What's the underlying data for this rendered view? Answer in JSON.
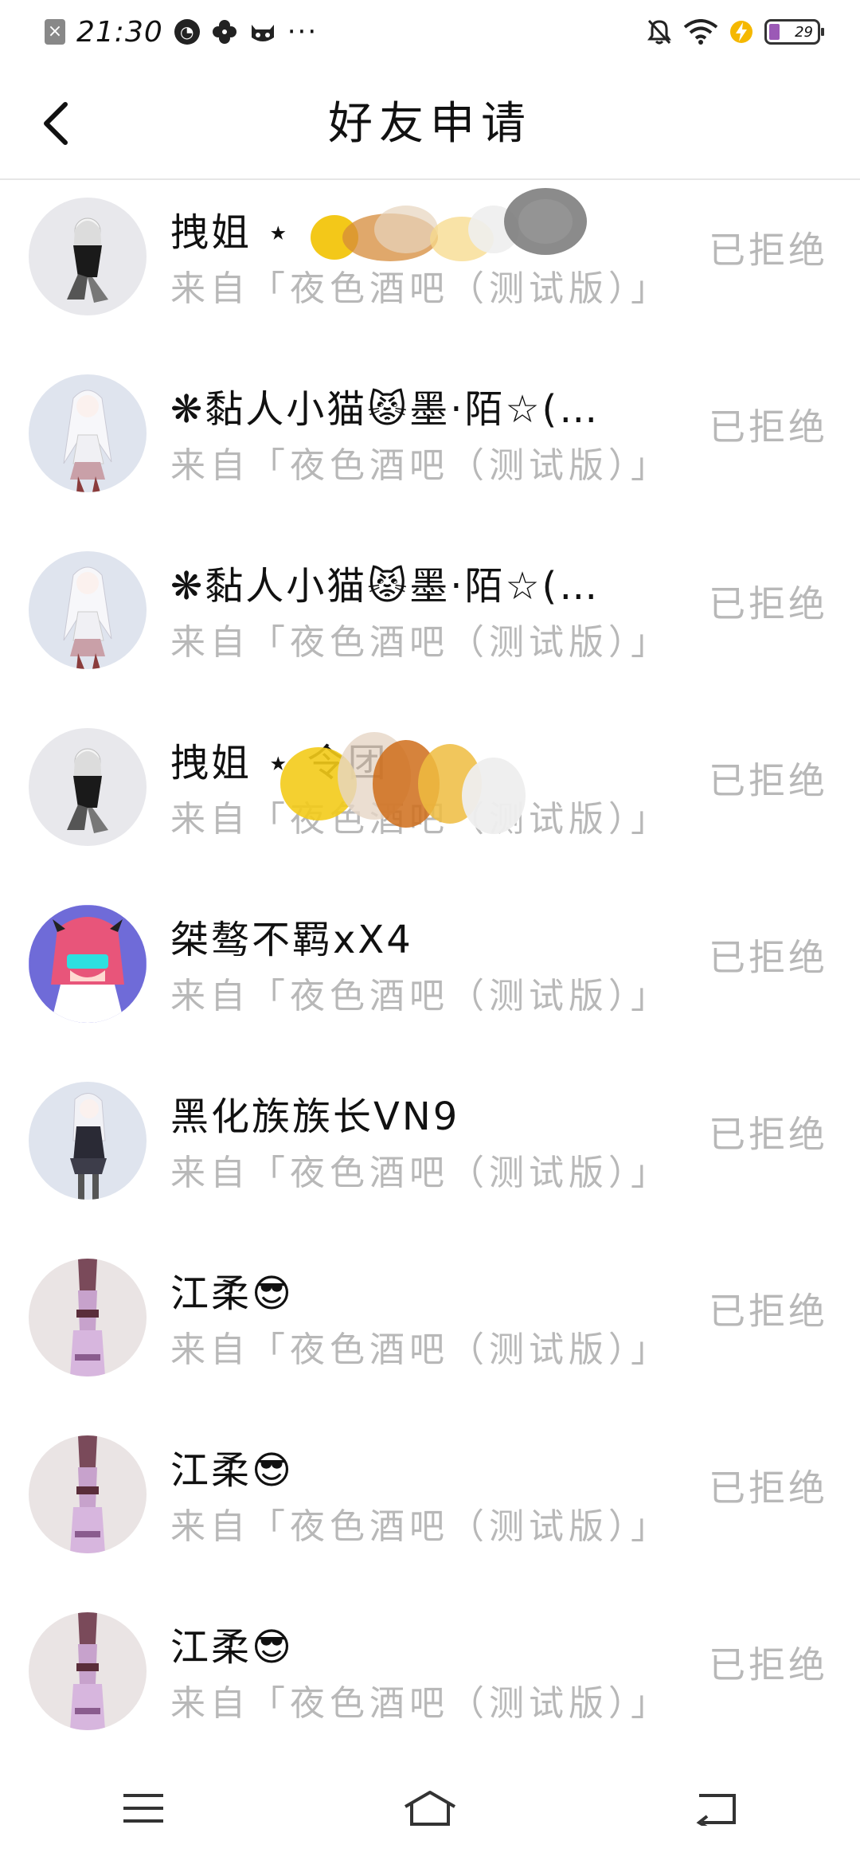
{
  "status_bar": {
    "time": "21:30",
    "battery_level": "29",
    "left_icons": [
      "notification-dismiss-icon",
      "app-icon-1",
      "pinwheel-icon",
      "cat-face-icon",
      "more-dots-icon"
    ],
    "right_icons": [
      "mute-bell-icon",
      "wifi-icon",
      "charging-icon",
      "battery-icon"
    ]
  },
  "header": {
    "title": "好友申请",
    "back_icon": "chevron-left-icon"
  },
  "requests": [
    {
      "name": "拽姐 ⋆ ",
      "source": "来自「夜色酒吧（测试版）」",
      "status": "已拒绝",
      "avatar": "white-hair-sitting"
    },
    {
      "name": "❋黏人小猫😾墨·陌☆(…",
      "source": "来自「夜色酒吧（测试版）」",
      "status": "已拒绝",
      "avatar": "white-hair-pink"
    },
    {
      "name": "❋黏人小猫😾墨·陌☆(…",
      "source": "来自「夜色酒吧（测试版）」",
      "status": "已拒绝",
      "avatar": "white-hair-pink"
    },
    {
      "name": "拽姐 ⋆                  令团",
      "source": "来自「夜色酒吧（测试版）」",
      "status": "已拒绝",
      "avatar": "white-hair-sitting"
    },
    {
      "name": "桀骜不羁xX4",
      "source": "来自「夜色酒吧（测试版）」",
      "status": "已拒绝",
      "avatar": "pink-hair-blue"
    },
    {
      "name": "黑化族族长VN9",
      "source": "来自「夜色酒吧（测试版）」",
      "status": "已拒绝",
      "avatar": "white-hair-standing"
    },
    {
      "name": "江柔😎",
      "source": "来自「夜色酒吧（测试版）」",
      "status": "已拒绝",
      "avatar": "pink-boots"
    },
    {
      "name": "江柔😎",
      "source": "来自「夜色酒吧（测试版）」",
      "status": "已拒绝",
      "avatar": "pink-boots"
    },
    {
      "name": "江柔😎",
      "source": "来自「夜色酒吧（测试版）」",
      "status": "已拒绝",
      "avatar": "pink-boots"
    }
  ],
  "nav_bar": {
    "icons": [
      "menu-icon",
      "home-icon",
      "back-icon"
    ]
  },
  "colors": {
    "background": "#ffffff",
    "muted_text": "#b8b8b8",
    "divider": "#e6e6e6"
  }
}
